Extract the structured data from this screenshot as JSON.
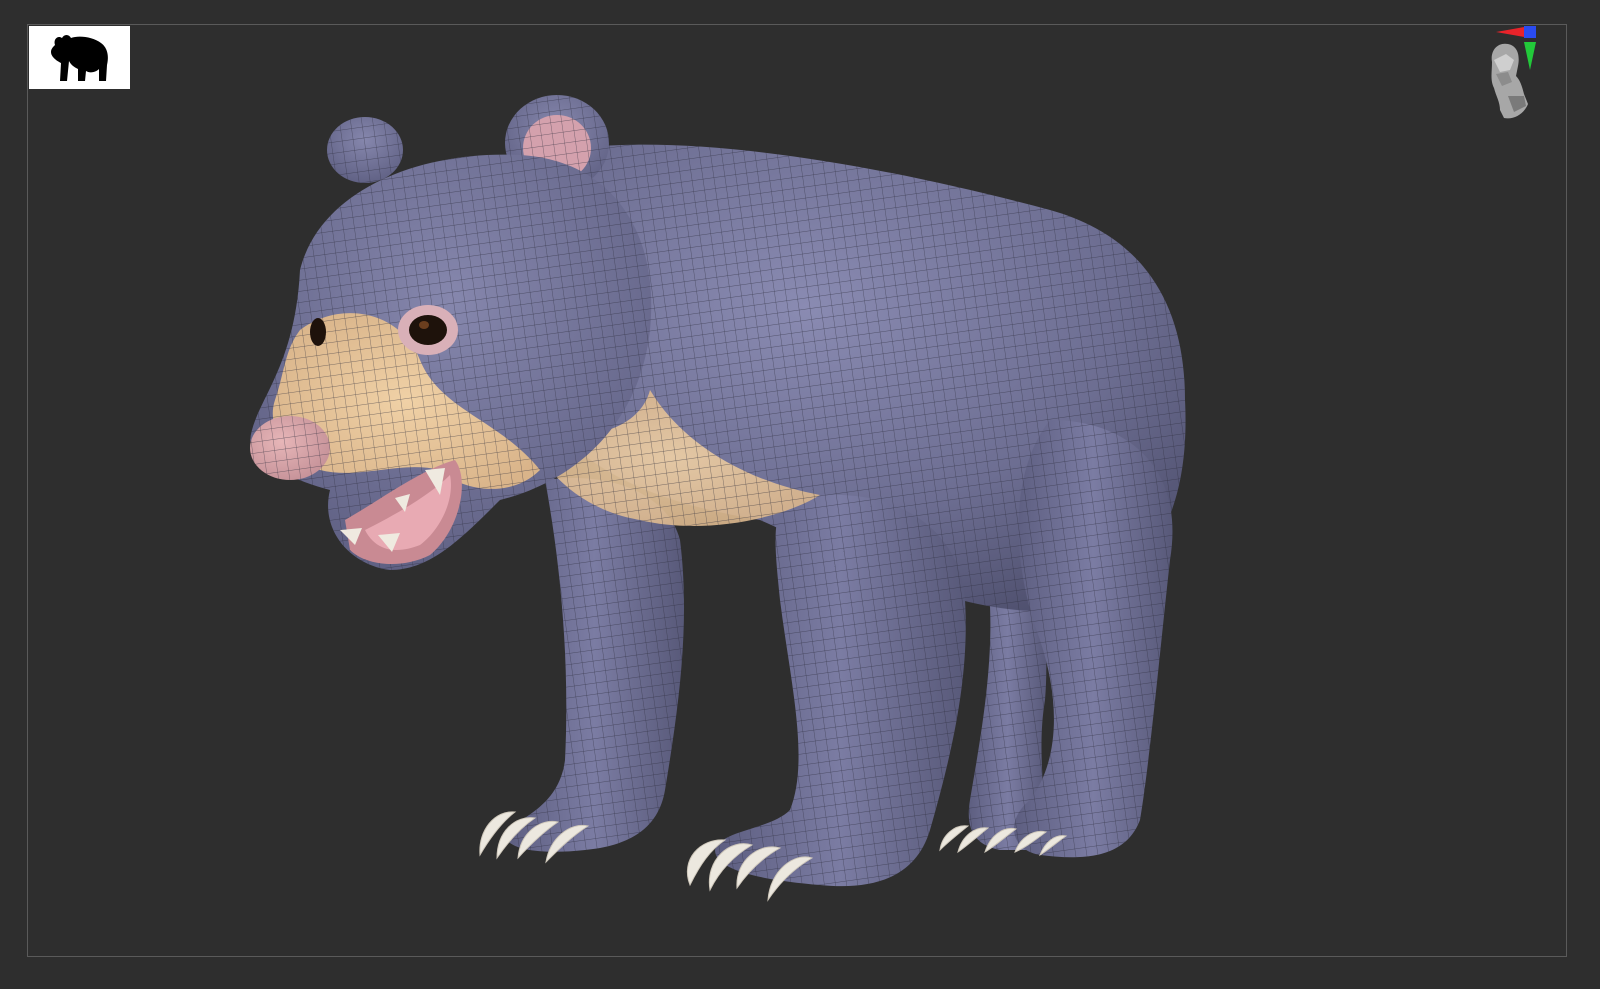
{
  "viewport": {
    "background": "#2e2e2e",
    "frame_color": "#5a5a5a"
  },
  "thumbnail": {
    "icon": "bear-silhouette-icon",
    "background": "#ffffff"
  },
  "gizmo": {
    "icon": "head-orientation-icon",
    "axes": {
      "x": "#e8232a",
      "y": "#22c93a",
      "z": "#2a4bf0"
    }
  },
  "model": {
    "subject": "bear-model",
    "body_color": "#6d6e92",
    "muzzle_color": "#e6c49a",
    "nose_color": "#d9a5a8",
    "claw_color": "#ece8df",
    "wire_color": "#2a2a3a"
  }
}
